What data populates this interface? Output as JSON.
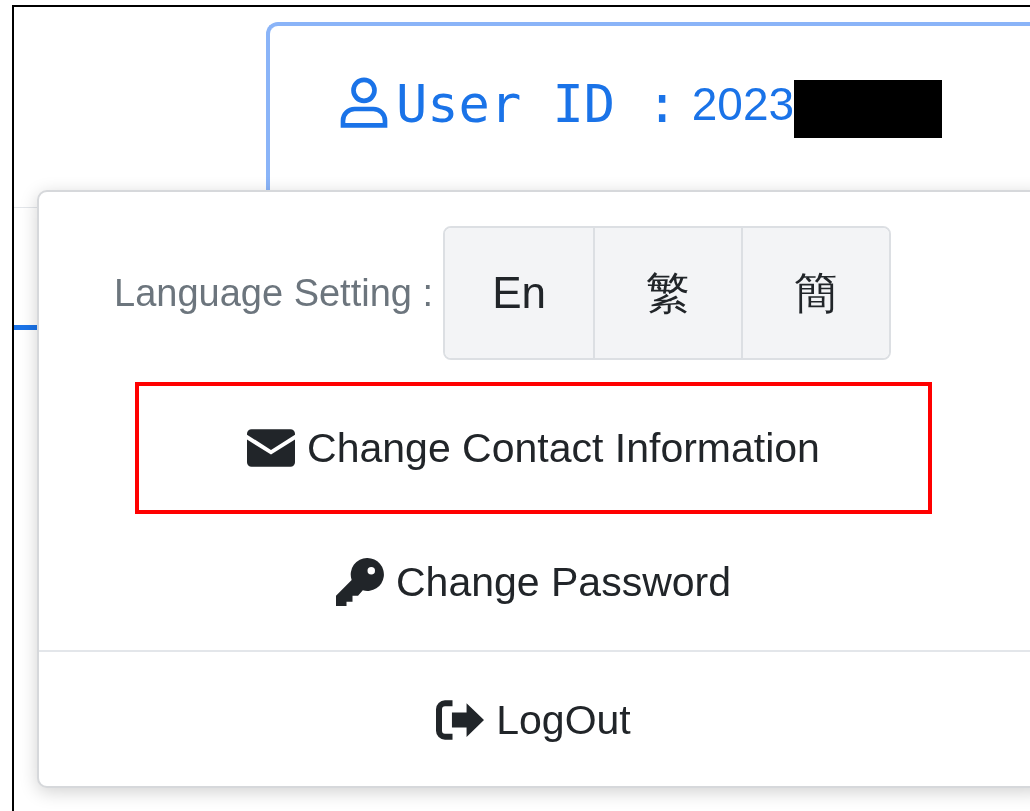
{
  "user_id": {
    "label": "User ID :",
    "value": "2023",
    "redacted": true
  },
  "menu": {
    "language": {
      "label": "Language Setting :",
      "options": [
        {
          "label": "En"
        },
        {
          "label": "繁"
        },
        {
          "label": "簡"
        }
      ]
    },
    "items": [
      {
        "kind": "contact",
        "label": "Change Contact Information",
        "highlighted": true
      },
      {
        "kind": "password",
        "label": "Change Password",
        "highlighted": false
      },
      {
        "kind": "logout",
        "label": "LogOut",
        "highlighted": false,
        "divider_before": true
      }
    ]
  }
}
